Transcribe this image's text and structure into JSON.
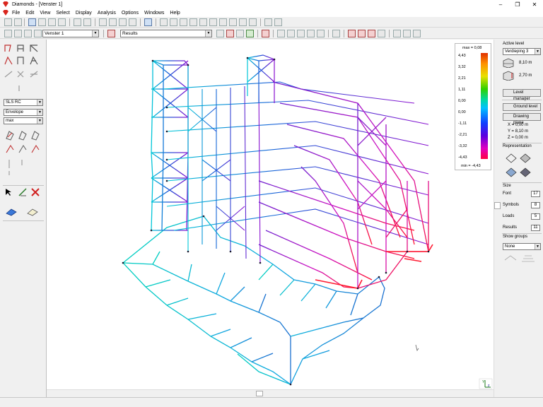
{
  "window": {
    "title": "Diamonds - [Venster 1]"
  },
  "menu": [
    "File",
    "Edit",
    "View",
    "Select",
    "Display",
    "Analysis",
    "Options",
    "Windows",
    "Help"
  ],
  "toolbar": {
    "window_select": "Venster 1",
    "results_select": "Results"
  },
  "left_panel": {
    "load_combo": "SLS RC",
    "envelope_combo": "Envelope",
    "max_combo": "max"
  },
  "legend": {
    "max_label": "max = 0,08",
    "min_label": "min = -4,43",
    "ticks": [
      "4,43",
      "3,32",
      "2,21",
      "1,11",
      "0,00",
      "0,00",
      "-1,11",
      "-2,21",
      "-3,32",
      "-4,43"
    ]
  },
  "right_panel": {
    "active_level_label": "Active level",
    "active_level_value": "Verdieping 3",
    "level_height_1": "8,10 m",
    "level_height_2": "2,70 m",
    "level_manager": "Level manager",
    "ground_level": "Ground level",
    "drawing_plane": "Drawing plane",
    "x_coord": "X =  0,00 m",
    "y_coord": "Y =  8,10 m",
    "z_coord": "Z =  0,00 m",
    "representation_label": "Representation",
    "size_label": "Size",
    "font_label": "Font",
    "font_value": "17",
    "symbols_label": "Symbols",
    "symbols_value": "8",
    "loads_label": "Loads",
    "loads_value": "5",
    "results_label": "Results",
    "results_value": "11",
    "show_groups_label": "Show groups",
    "show_groups_value": "None"
  },
  "axis_labels": {
    "y": "Y",
    "z": "z"
  },
  "colors": {
    "accent_red": "#d9251d",
    "window_bg": "#f0f0f0"
  }
}
